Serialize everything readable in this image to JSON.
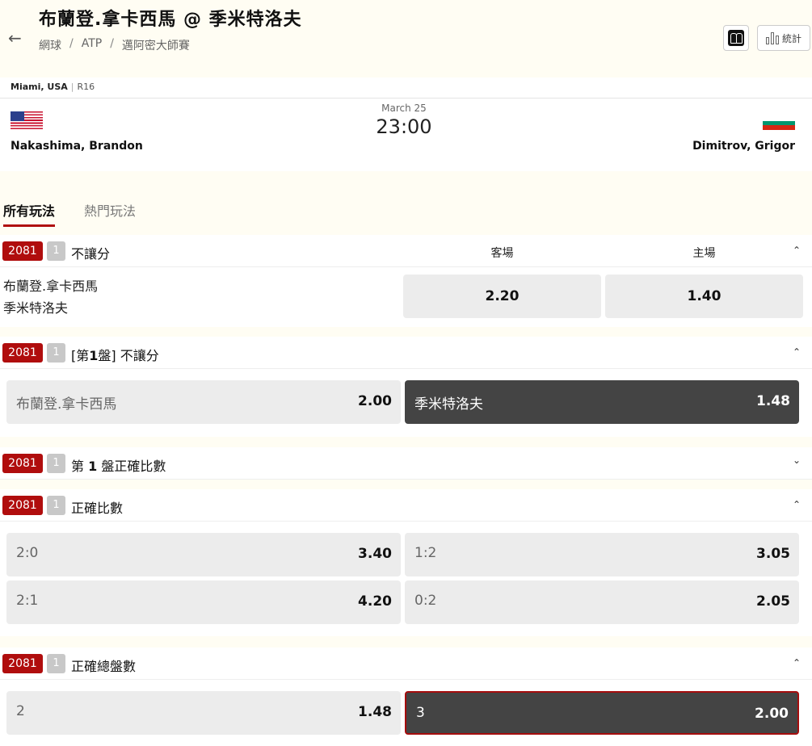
{
  "header": {
    "title": "布蘭登.拿卡西馬 @ 季米特洛夫",
    "breadcrumb": [
      "網球",
      "ATP",
      "邁阿密大師賽"
    ],
    "breadcrumb_sep": "/",
    "stats_label": "統計"
  },
  "match": {
    "venue": "Miami, USA",
    "round": "R16",
    "date": "March 25",
    "time": "23:00",
    "home_player": "Nakashima, Brandon",
    "away_player": "Dimitrov, Grigor",
    "flag_colors": {
      "bulgaria": [
        "#ffffff",
        "#00966e",
        "#d62612"
      ]
    }
  },
  "tabs": [
    {
      "label": "所有玩法",
      "active": true
    },
    {
      "label": "熱門玩法",
      "active": false
    }
  ],
  "sections": {
    "moneyline": {
      "id": "2081",
      "count": "1",
      "title": "不讓分",
      "col_away": "客場",
      "col_home": "主場",
      "names": [
        "布蘭登.拿卡西馬",
        "季米特洛夫"
      ],
      "away_odd": "2.20",
      "home_odd": "1.40"
    },
    "set1_moneyline": {
      "id": "2081",
      "count": "1",
      "title_pre": "[第",
      "title_num": "1",
      "title_post": "盤] 不讓分",
      "options": [
        {
          "label": "布蘭登.拿卡西馬",
          "odd": "2.00"
        },
        {
          "label": "季米特洛夫",
          "odd": "1.48"
        }
      ]
    },
    "set1_score": {
      "id": "2081",
      "count": "1",
      "title_pre": "第 ",
      "title_num": "1",
      "title_post": " 盤正確比數"
    },
    "correct_score": {
      "id": "2081",
      "count": "1",
      "title": "正確比數",
      "options": [
        {
          "label": "2:0",
          "odd": "3.40"
        },
        {
          "label": "1:2",
          "odd": "3.05"
        },
        {
          "label": "2:1",
          "odd": "4.20"
        },
        {
          "label": "0:2",
          "odd": "2.05"
        }
      ]
    },
    "total_sets": {
      "id": "2081",
      "count": "1",
      "title": "正確總盤數",
      "options": [
        {
          "label": "2",
          "odd": "1.48"
        },
        {
          "label": "3",
          "odd": "2.00"
        }
      ]
    }
  },
  "colors": {
    "accent": "#b00d0d",
    "selected": "#444444",
    "odd_bg": "#ececec",
    "page_bg": "#fffdf3"
  }
}
